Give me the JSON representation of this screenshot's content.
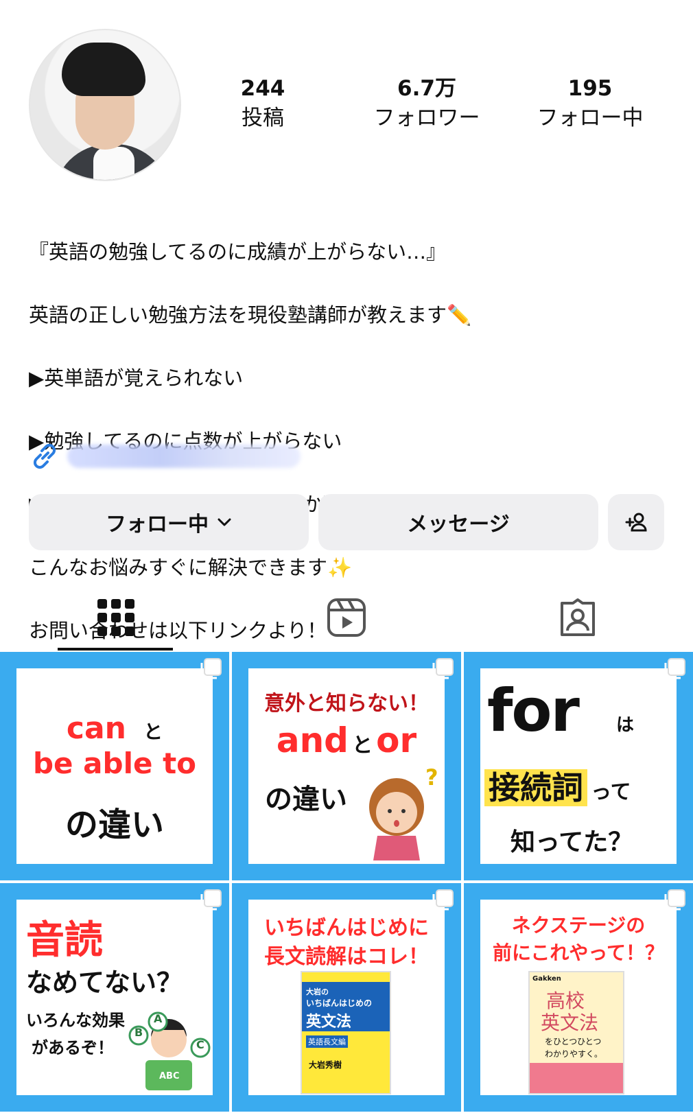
{
  "profile": {
    "stats": [
      {
        "value": "244",
        "label": "投稿"
      },
      {
        "value": "6.7万",
        "label": "フォロワー"
      },
      {
        "value": "195",
        "label": "フォロー中"
      }
    ],
    "bio_lines": [
      "『英語の勉強してるのに成績が上がらない…』",
      "英語の正しい勉強方法を現役塾講師が教えます",
      "▶英単語が覚えられない",
      "▶勉強してるのに点数が上がらない",
      "▶今の勉強方法を続けていいのか不安",
      "こんなお悩みすぐに解決できます",
      "お問い合わせは以下リンクより！"
    ],
    "bio_emojis": {
      "pencil": "✏️",
      "sparkles": "✨"
    }
  },
  "buttons": {
    "follow": "フォロー中",
    "message": "メッセージ"
  },
  "tabs": [
    "grid-icon",
    "reels-icon",
    "tagged-icon"
  ],
  "posts": [
    {
      "lines": [
        "can",
        "と",
        "be able to",
        "の違い"
      ]
    },
    {
      "lines": [
        "意外と知らない！",
        "and",
        "と",
        "or",
        "の違い",
        "?"
      ]
    },
    {
      "lines": [
        "for",
        "は",
        "接続詞",
        "って",
        "知ってた？"
      ]
    },
    {
      "lines": [
        "音読",
        "なめてない？",
        "いろんな効果",
        "があるぞ！",
        "A",
        "B",
        "C",
        "ABC"
      ]
    },
    {
      "lines": [
        "いちばんはじめに",
        "長文読解はコレ！",
        "大岩の",
        "いちばんはじめの",
        "英文法",
        "英語長文編",
        "大岩秀樹"
      ]
    },
    {
      "lines": [
        "ネクステージの",
        "前にこれやって！？",
        "Gakken",
        "高校",
        "英文法",
        "をひとつひとつ",
        "わかりやすく。"
      ]
    }
  ],
  "colors": {
    "grid_bg": "#3aabef",
    "red_text": "#ff2d2d",
    "link_blue": "#2a7de1"
  }
}
